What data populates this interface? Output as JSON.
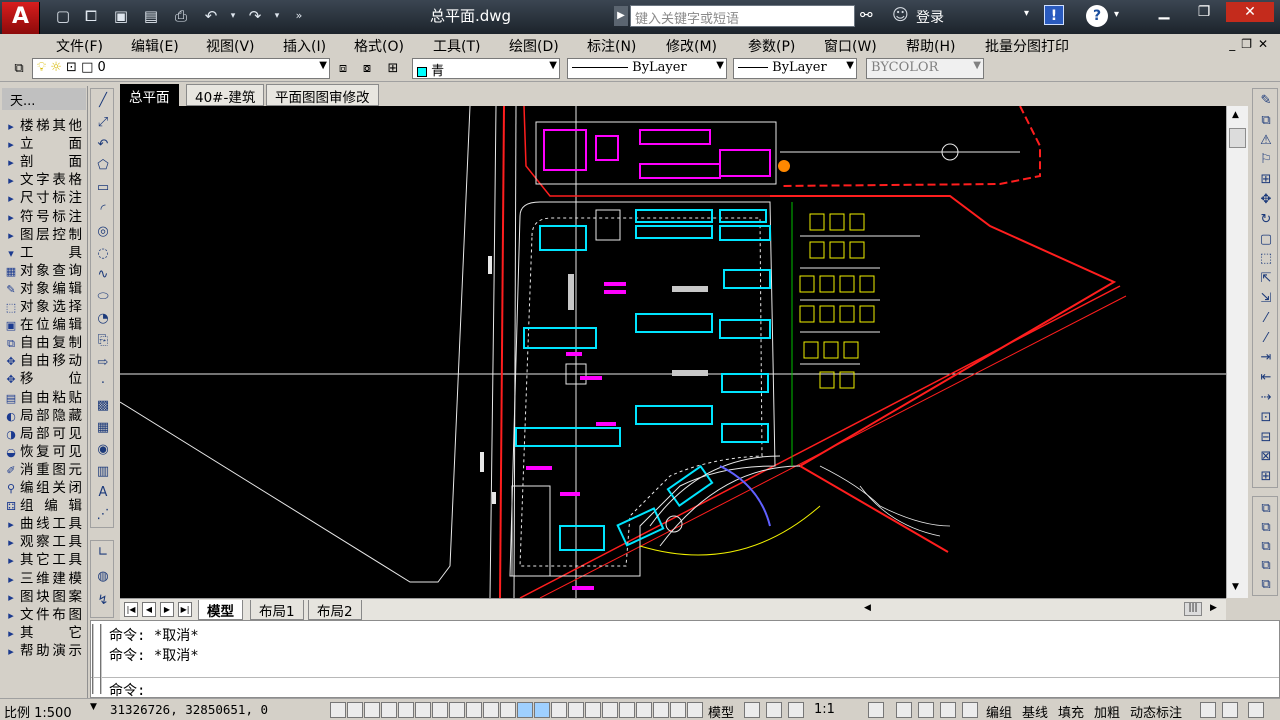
{
  "app": {
    "title": "总平面.dwg",
    "logo_letter": "A",
    "search_placeholder": "键入关键字或短语",
    "login_label": "登录",
    "exchange_icon": "!",
    "help_icon": "?"
  },
  "quick_access": [
    "new-icon",
    "open-icon",
    "save-icon",
    "saveas-icon",
    "print-icon",
    "undo-icon",
    "redo-icon"
  ],
  "menu": [
    "文件(F)",
    "编辑(E)",
    "视图(V)",
    "插入(I)",
    "格式(O)",
    "工具(T)",
    "绘图(D)",
    "标注(N)",
    "修改(M)",
    "参数(P)",
    "窗口(W)",
    "帮助(H)",
    "批量分图打印"
  ],
  "layer_toolbar": {
    "layer_value": "0",
    "color_value": "青",
    "linetype_value": "ByLayer",
    "lineweight_value": "ByLayer",
    "plotstyle_value": "BYCOLOR",
    "color_swatch": "#00ffff"
  },
  "left_panel": {
    "header": "天...",
    "items": [
      {
        "icon": "▸",
        "label": "楼梯其他"
      },
      {
        "icon": "▸",
        "label": "立面"
      },
      {
        "icon": "▸",
        "label": "剖面"
      },
      {
        "icon": "▸",
        "label": "文字表格"
      },
      {
        "icon": "▸",
        "label": "尺寸标注"
      },
      {
        "icon": "▸",
        "label": "符号标注"
      },
      {
        "icon": "▸",
        "label": "图层控制"
      },
      {
        "icon": "▾",
        "label": "工具"
      },
      {
        "icon": "▦",
        "label": "对象查询"
      },
      {
        "icon": "✎",
        "label": "对象编辑"
      },
      {
        "icon": "⬚",
        "label": "对象选择"
      },
      {
        "icon": "▣",
        "label": "在位编辑"
      },
      {
        "icon": "⧉",
        "label": "自由复制"
      },
      {
        "icon": "✥",
        "label": "自由移动"
      },
      {
        "icon": "✥",
        "label": "移位"
      },
      {
        "icon": "▤",
        "label": "自由粘贴"
      },
      {
        "icon": "◐",
        "label": "局部隐藏"
      },
      {
        "icon": "◑",
        "label": "局部可见"
      },
      {
        "icon": "◒",
        "label": "恢复可见"
      },
      {
        "icon": "✐",
        "label": "消重图元"
      },
      {
        "icon": "⚲",
        "label": "编组关闭"
      },
      {
        "icon": "⚃",
        "label": "组编辑"
      },
      {
        "icon": "▸",
        "label": "曲线工具"
      },
      {
        "icon": "▸",
        "label": "观察工具"
      },
      {
        "icon": "▸",
        "label": "其它工具"
      },
      {
        "icon": "▸",
        "label": "三维建模"
      },
      {
        "icon": "▸",
        "label": "图块图案"
      },
      {
        "icon": "▸",
        "label": "文件布图"
      },
      {
        "icon": "▸",
        "label": "其它"
      },
      {
        "icon": "▸",
        "label": "帮助演示"
      }
    ]
  },
  "draw_tools": [
    "╱",
    "⤢",
    "↶",
    "⬠",
    "▭",
    "◜",
    "◎",
    "◌",
    "∿",
    "⬭",
    "◔",
    "⎘",
    "⇨",
    "·",
    "▩",
    "▦",
    "◉",
    "▥",
    "A",
    "⋰"
  ],
  "draw_tools2": [
    "∟",
    "◍",
    "↯"
  ],
  "right_tools": [
    "✎",
    "⧉",
    "⚠",
    "⚐",
    "⊞",
    "✥",
    "↻",
    "▢",
    "⬚",
    "⇱",
    "⇲",
    "⁄",
    "⁄",
    "⇥",
    "⇤",
    "⇢",
    "⊡",
    "⊟",
    "⊠",
    "⊞"
  ],
  "right_tools2": [
    "⧉",
    "⧉",
    "⧉",
    "⧉",
    "⧉"
  ],
  "doc_tabs": [
    "总平面",
    "40#-建筑",
    "平面图图审修改"
  ],
  "layout_tabs": [
    "模型",
    "布局1",
    "布局2"
  ],
  "command": {
    "history": [
      "命令: *取消*",
      "命令: *取消*"
    ],
    "prompt": "命令:"
  },
  "status": {
    "scale": "比例 1:500",
    "coords": "31326726, 32850651, 0",
    "model_label": "模型",
    "annotation_scale": "1:1",
    "toggles": [
      "编组",
      "基线",
      "填充",
      "加粗",
      "动态标注"
    ]
  },
  "colors": {
    "canvas": "#000000",
    "red": "#ff1e1e",
    "magenta": "#ff00ff",
    "cyan": "#00e5ff",
    "white": "#e8e8e8",
    "yellow": "#f0f000",
    "green": "#00c000"
  }
}
